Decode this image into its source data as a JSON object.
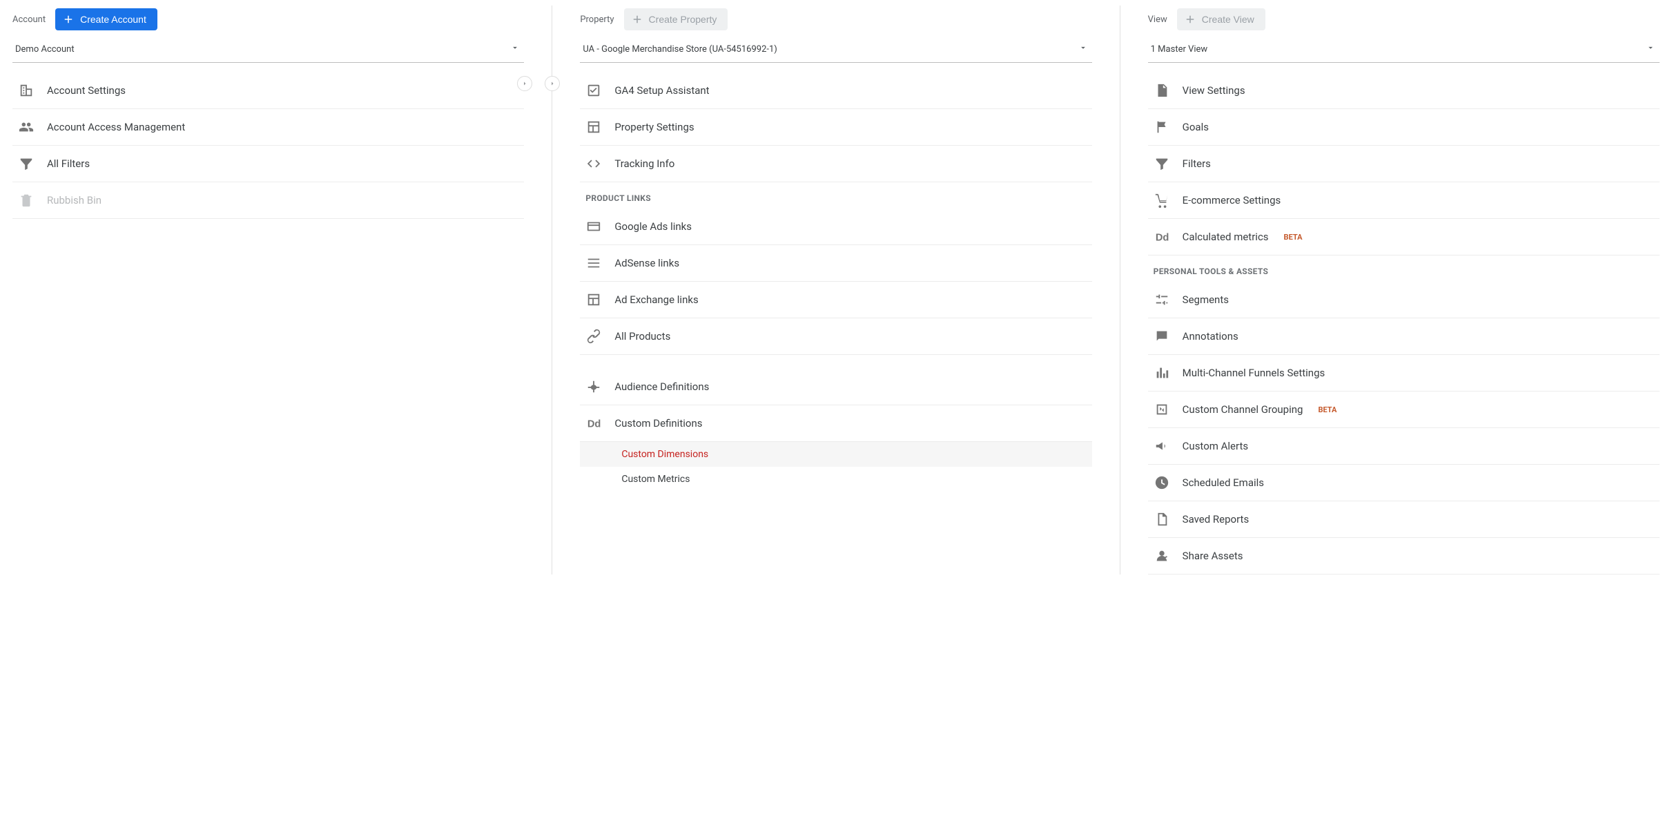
{
  "columns": {
    "account": {
      "label": "Account",
      "create_label": "Create Account",
      "create_enabled": true,
      "selector": "Demo Account",
      "items": [
        {
          "id": "account-settings",
          "label": "Account Settings",
          "icon": "building"
        },
        {
          "id": "account-access",
          "label": "Account Access Management",
          "icon": "people"
        },
        {
          "id": "all-filters",
          "label": "All Filters",
          "icon": "funnel"
        },
        {
          "id": "rubbish-bin",
          "label": "Rubbish Bin",
          "icon": "trash",
          "disabled": true
        }
      ]
    },
    "property": {
      "label": "Property",
      "create_label": "Create Property",
      "create_enabled": false,
      "selector": "UA - Google Merchandise Store (UA-54516992-1)",
      "items_top": [
        {
          "id": "ga4-setup",
          "label": "GA4 Setup Assistant",
          "icon": "checkbox"
        },
        {
          "id": "property-settings",
          "label": "Property Settings",
          "icon": "layout"
        },
        {
          "id": "tracking-info",
          "label": "Tracking Info",
          "icon": "code"
        }
      ],
      "product_links_header": "PRODUCT LINKS",
      "product_links": [
        {
          "id": "google-ads-links",
          "label": "Google Ads links",
          "icon": "card"
        },
        {
          "id": "adsense-links",
          "label": "AdSense links",
          "icon": "list"
        },
        {
          "id": "ad-exchange-links",
          "label": "Ad Exchange links",
          "icon": "layout"
        },
        {
          "id": "all-products",
          "label": "All Products",
          "icon": "link"
        }
      ],
      "items_bottom": [
        {
          "id": "audience-definitions",
          "label": "Audience Definitions",
          "icon": "fork"
        },
        {
          "id": "custom-definitions",
          "label": "Custom Definitions",
          "icon": "dd"
        }
      ],
      "custom_sub": [
        {
          "id": "custom-dimensions",
          "label": "Custom Dimensions",
          "active": true
        },
        {
          "id": "custom-metrics",
          "label": "Custom Metrics"
        }
      ]
    },
    "view": {
      "label": "View",
      "create_label": "Create View",
      "create_enabled": false,
      "selector": "1 Master View",
      "items_top": [
        {
          "id": "view-settings",
          "label": "View Settings",
          "icon": "page"
        },
        {
          "id": "goals",
          "label": "Goals",
          "icon": "flag"
        },
        {
          "id": "filters",
          "label": "Filters",
          "icon": "funnel"
        },
        {
          "id": "ecommerce-settings",
          "label": "E-commerce Settings",
          "icon": "cart"
        },
        {
          "id": "calculated-metrics",
          "label": "Calculated metrics",
          "icon": "dd",
          "beta": "BETA"
        }
      ],
      "personal_header": "PERSONAL TOOLS & ASSETS",
      "personal_items": [
        {
          "id": "segments",
          "label": "Segments",
          "icon": "sliders"
        },
        {
          "id": "annotations",
          "label": "Annotations",
          "icon": "comment"
        },
        {
          "id": "mcf-settings",
          "label": "Multi-Channel Funnels Settings",
          "icon": "bars"
        },
        {
          "id": "custom-channel-grouping",
          "label": "Custom Channel Grouping",
          "icon": "swap",
          "beta": "BETA"
        },
        {
          "id": "custom-alerts",
          "label": "Custom Alerts",
          "icon": "megaphone"
        },
        {
          "id": "scheduled-emails",
          "label": "Scheduled Emails",
          "icon": "clock"
        },
        {
          "id": "saved-reports",
          "label": "Saved Reports",
          "icon": "doc"
        },
        {
          "id": "share-assets",
          "label": "Share Assets",
          "icon": "share"
        }
      ]
    }
  }
}
